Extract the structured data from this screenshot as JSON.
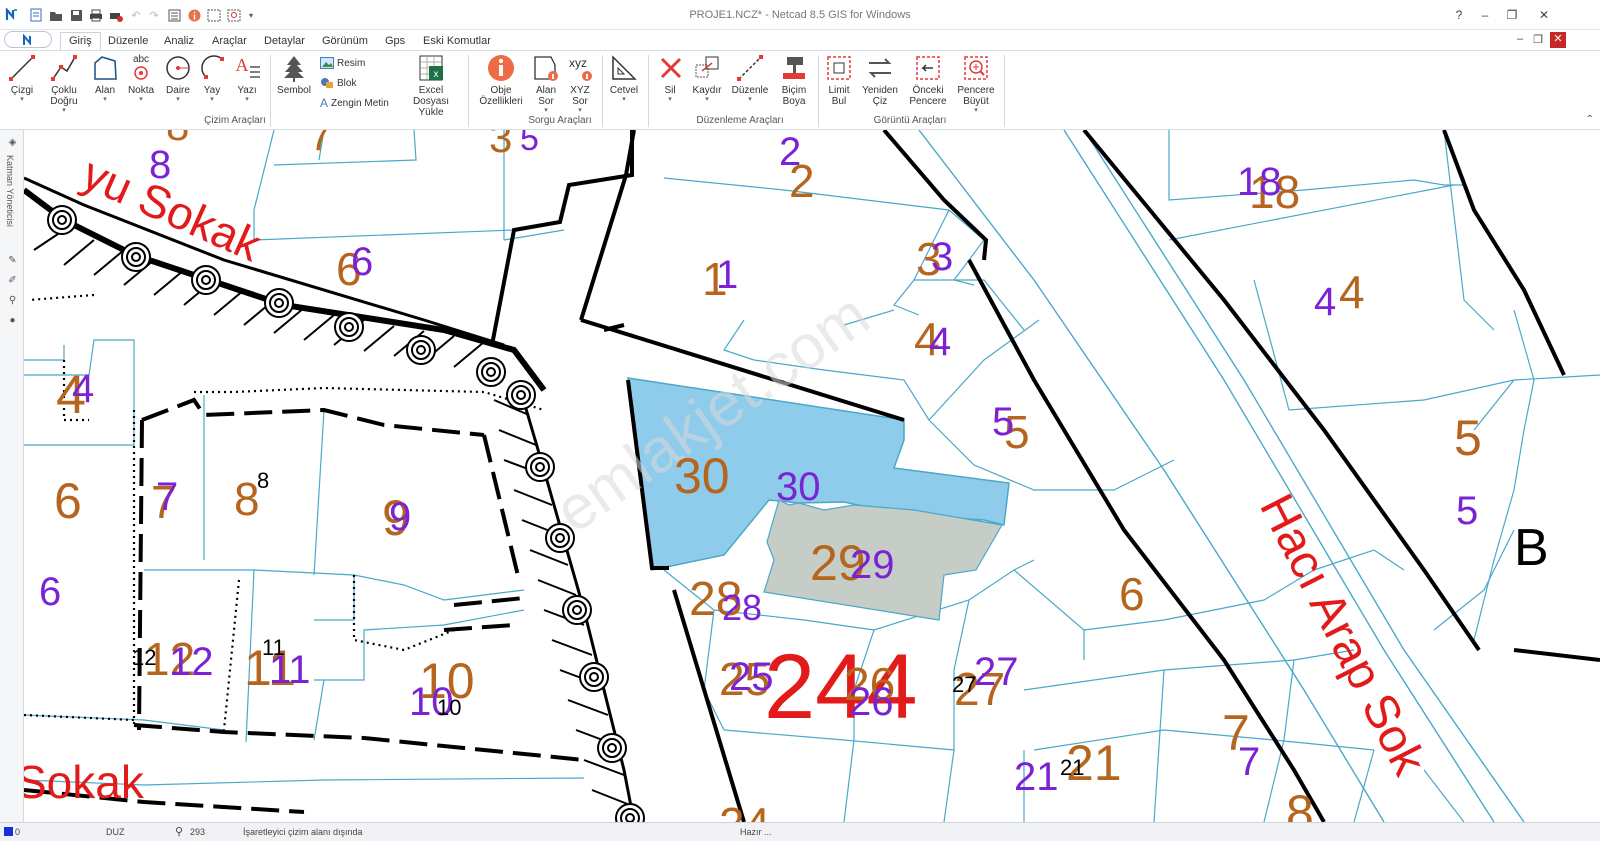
{
  "titlebar": {
    "title": "PROJE1.NCZ* - Netcad 8.5 GIS for Windows",
    "help": "?",
    "minimize": "–",
    "restore": "❐",
    "close": "✕"
  },
  "tabs": [
    {
      "label": "Giriş",
      "active": true
    },
    {
      "label": "Düzenle"
    },
    {
      "label": "Analiz"
    },
    {
      "label": "Araçlar"
    },
    {
      "label": "Detaylar"
    },
    {
      "label": "Görünüm"
    },
    {
      "label": "Gps"
    },
    {
      "label": "Eski Komutlar"
    }
  ],
  "ribbon": {
    "cizim": {
      "group_label": "Çizim Araçları",
      "cizgi": "Çizgi",
      "coklu_1": "Çoklu",
      "coklu_2": "Doğru",
      "alan": "Alan",
      "nokta": "Nokta",
      "nokta_icon_text": "abc",
      "daire": "Daire",
      "yay": "Yay",
      "yazi": "Yazı",
      "yazi_icon_text": "A",
      "sembol": "Sembol",
      "resim": "Resim",
      "blok": "Blok",
      "zengin_metin": "Zengin Metin",
      "excel_1": "Excel Dosyası",
      "excel_2": "Yükle",
      "excel_icon_text": "x"
    },
    "sorgu": {
      "group_label": "Sorgu Araçları",
      "obje_1": "Obje",
      "obje_2": "Özellikleri",
      "alan_sor_1": "Alan",
      "alan_sor_2": "Sor",
      "xyz_icon_text": "xyz",
      "xyz_1": "XYZ",
      "xyz_2": "Sor",
      "cetvel": "Cetvel"
    },
    "duzenleme": {
      "group_label": "Düzenleme Araçları",
      "sil": "Sil",
      "kaydir": "Kaydır",
      "duzenle": "Düzenle",
      "bicim_1": "Biçim",
      "bicim_2": "Boya"
    },
    "goruntu": {
      "group_label": "Görüntü Araçları",
      "limit_1": "Limit",
      "limit_2": "Bul",
      "yeniden_1": "Yeniden",
      "yeniden_2": "Çiz",
      "onceki_1": "Önceki",
      "onceki_2": "Pencere",
      "buyut_1": "Pencere",
      "buyut_2": "Büyüt"
    }
  },
  "left_panel": {
    "title": "Katman Yöneticisi"
  },
  "map": {
    "street_labels": [
      "yu Sokak",
      "Sokak",
      "Hacı Arap Sok"
    ],
    "block_number": "244",
    "block_letter": "B",
    "watermark": "emlakjet.com",
    "orange_labels": [
      "8",
      "7",
      "3",
      "6",
      "2",
      "1",
      "3",
      "18",
      "4",
      "4",
      "4",
      "5",
      "6",
      "7",
      "8",
      "9",
      "30",
      "5",
      "12",
      "11",
      "10",
      "28",
      "29",
      "25",
      "26",
      "27",
      "6",
      "21",
      "7",
      "8",
      "24"
    ],
    "purple_labels": [
      "8",
      "5",
      "6",
      "4",
      "7",
      "9",
      "2",
      "1",
      "3",
      "18",
      "4",
      "4",
      "5",
      "30",
      "6",
      "12",
      "11",
      "10",
      "29",
      "28",
      "25",
      "26",
      "27",
      "21",
      "7",
      "5"
    ],
    "black_labels": [
      "8",
      "12",
      "11",
      "10",
      "27",
      "21"
    ],
    "colors": {
      "parcel_line": "#4aa8c8",
      "selected_fill": "#8fcbea",
      "building_fill": "#c5cdc6",
      "orange_text": "#b5651d",
      "purple_text": "#7a22d4",
      "red_text": "#e21a1a"
    }
  },
  "statusbar": {
    "layer": "0",
    "mode": "DUZ",
    "zoom": "293",
    "message": "İşaretleyici çizim alanı dışında",
    "status": "Hazır ..."
  }
}
